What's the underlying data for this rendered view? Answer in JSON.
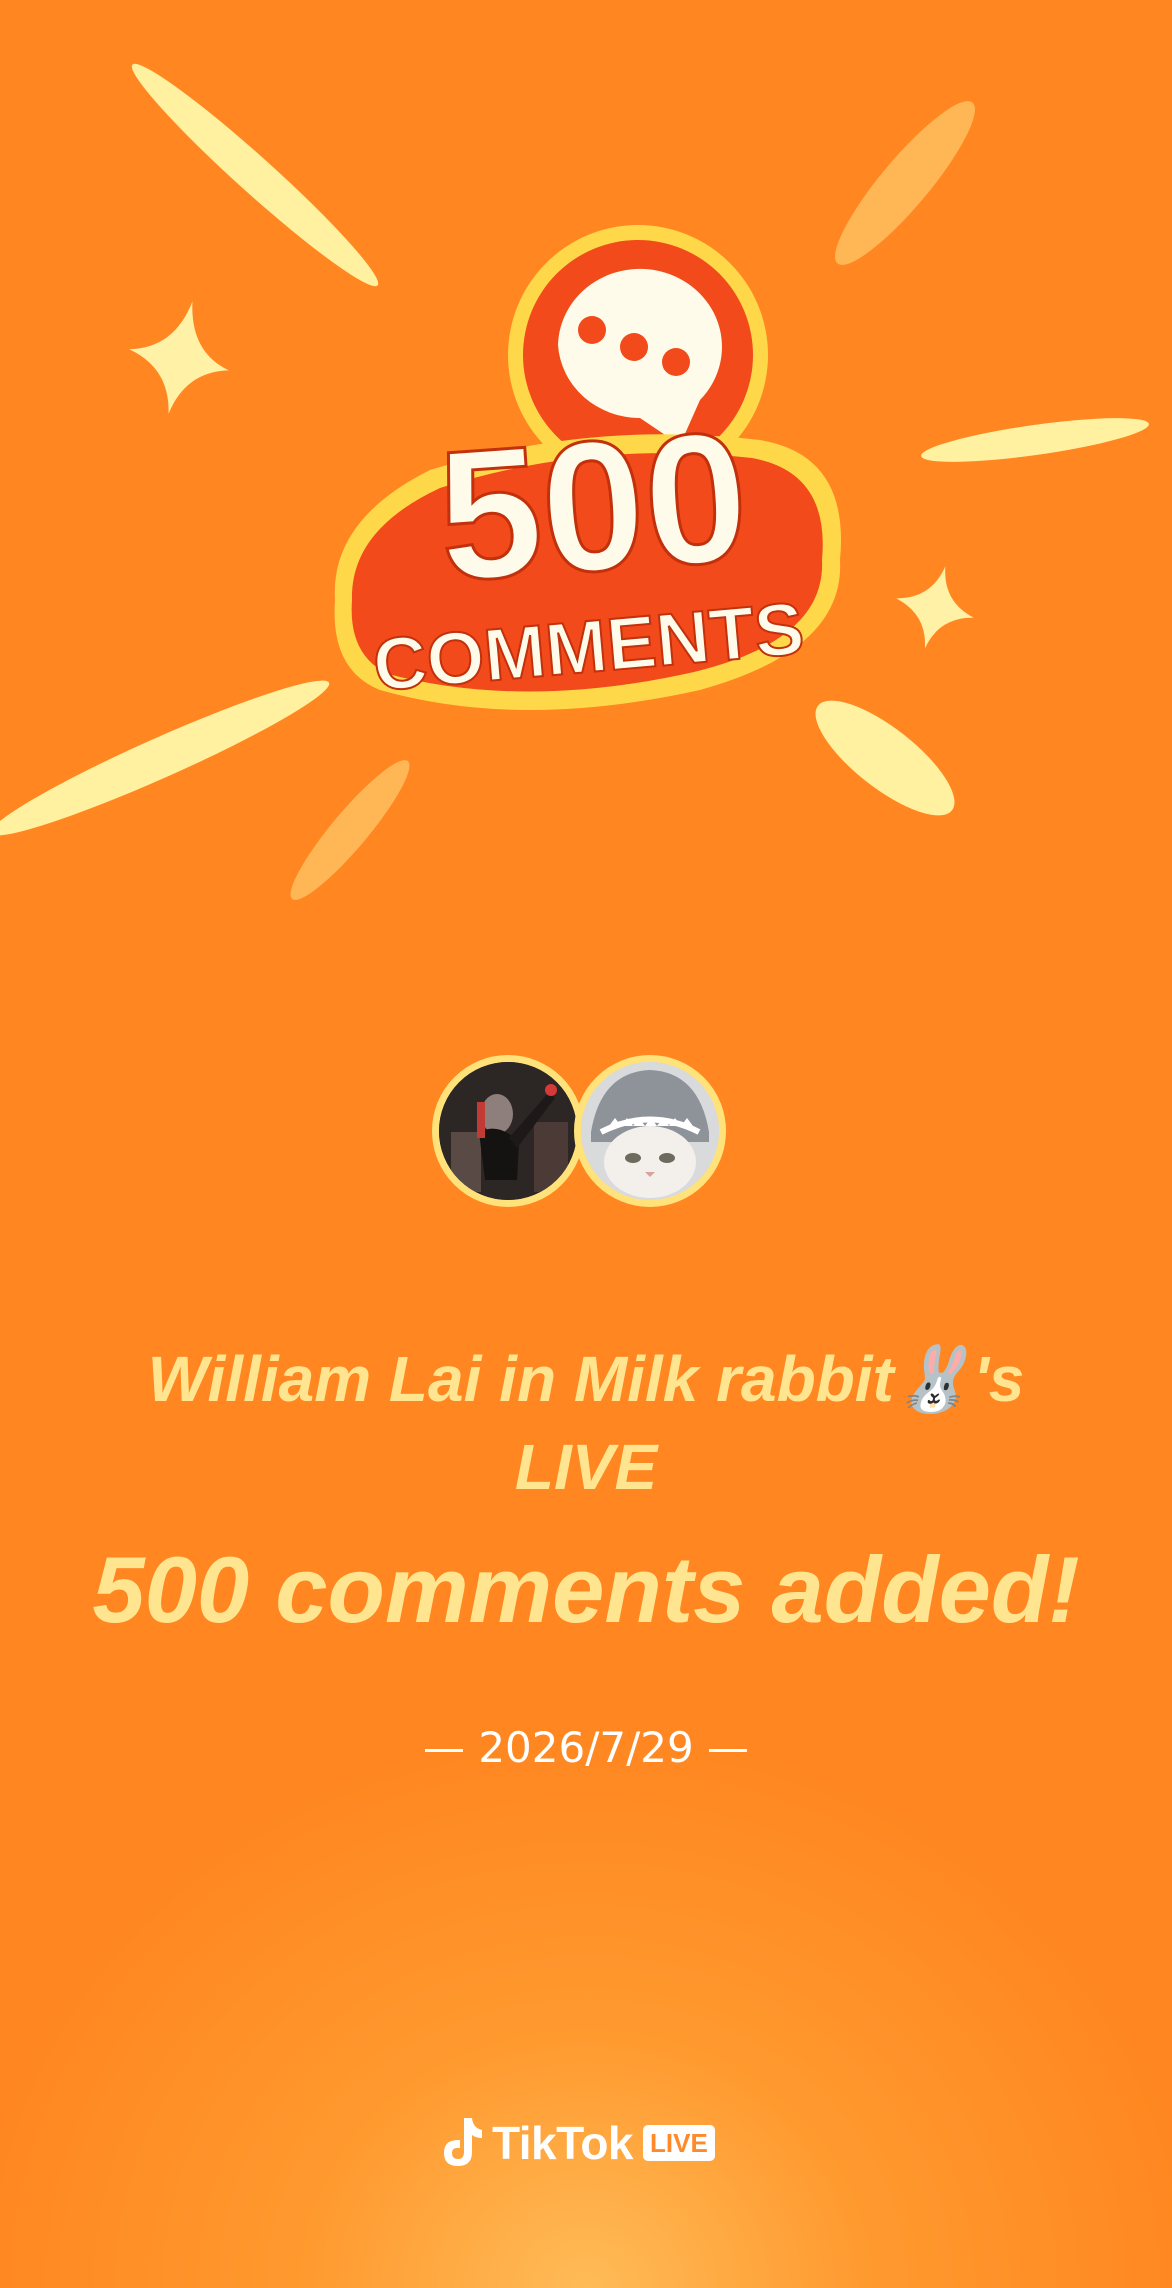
{
  "badge": {
    "number": "500",
    "word": "COMMENTS"
  },
  "avatars": [
    {
      "name": "streamer-avatar"
    },
    {
      "name": "viewer-avatar"
    }
  ],
  "live": {
    "title_line1": "William Lai in Milk rabbit🐰's",
    "title_line2": "LIVE"
  },
  "headline": "500 comments added!",
  "date": "— 2026/7/29 —",
  "brand": {
    "name": "TikTok",
    "badge": "LIVE",
    "icon": "tiktok-note-icon"
  },
  "colors": {
    "background": "#FF8620",
    "accent_text": "#FFE590",
    "badge_red": "#F24A1A",
    "badge_outline": "#FFD84A",
    "sparkle": "#FFF1A6"
  }
}
